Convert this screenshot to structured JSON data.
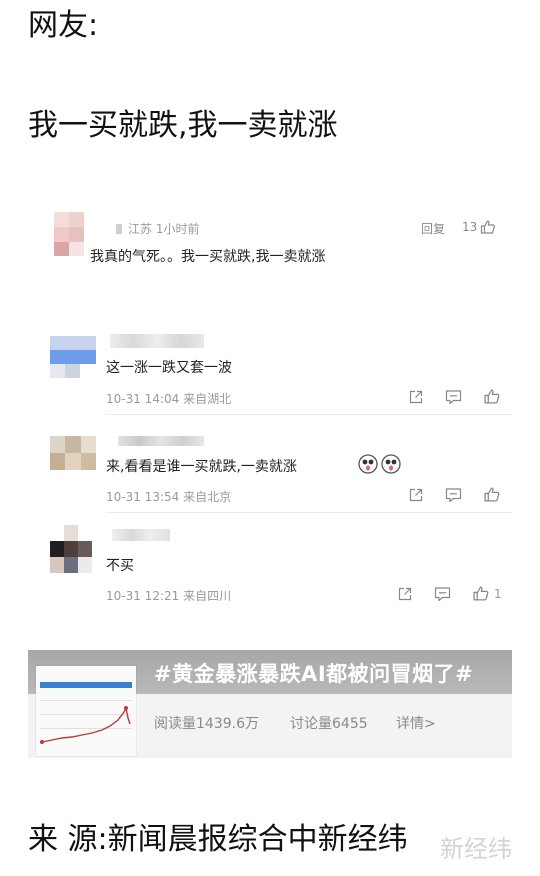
{
  "heading": {
    "netizen_label": "网友:",
    "quote": "我一买就跌,我一卖就涨",
    "source": "来 源:新闻晨报综合中新经纬"
  },
  "top_comment": {
    "location_time": "江苏 1小时前",
    "reply_label": "回复",
    "like_count": "13",
    "text": "我真的气死。。我一买就跌,我一卖就涨"
  },
  "comments": [
    {
      "text": "这一涨一跌又套一波",
      "meta": "10-31 14:04 来自湖北",
      "like_count": ""
    },
    {
      "text": "来,看看是谁一买就跌,一卖就涨",
      "meta": "10-31 13:54 来自北京",
      "like_count": "",
      "emojis": [
        "surprised-emoji-icon",
        "surprised-emoji-icon"
      ]
    },
    {
      "text": "不买",
      "meta": "10-31 12:21 来自四川",
      "like_count": "1"
    }
  ],
  "topic_card": {
    "hashtag": "#黄金暴涨暴跌AI都被问冒烟了#",
    "reads": "阅读量1439.6万",
    "discussions": "讨论量6455",
    "details_link": "详情>"
  },
  "watermark": "新经纬",
  "colors": {
    "meta_gray": "#9a9a9a",
    "card_bg": "#f3f3f3",
    "hashtag_bg": "#b0b0b0"
  }
}
